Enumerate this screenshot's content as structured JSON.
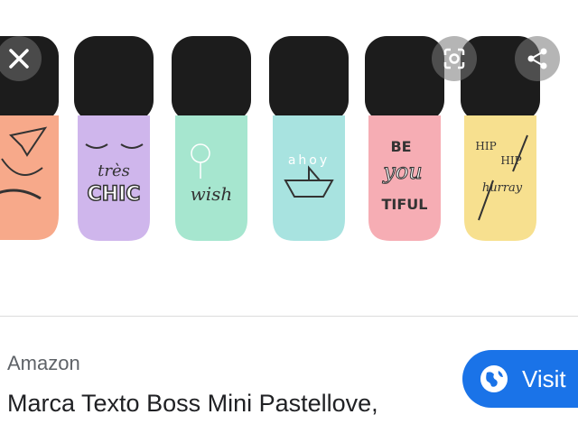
{
  "product_image": {
    "highlighters": [
      {
        "cap": "#1c1c1c",
        "body": "#f7a98a",
        "doodle": "paper-plane"
      },
      {
        "cap": "#1c1c1c",
        "body": "#cfb6ec",
        "doodle": "lashes",
        "text_lines": [
          "très",
          "CHIC"
        ]
      },
      {
        "cap": "#1c1c1c",
        "body": "#a6e6cf",
        "doodle": "dandelion",
        "text_lines": [
          "wish"
        ]
      },
      {
        "cap": "#1c1c1c",
        "body": "#a8e3e0",
        "doodle": "paper-boat",
        "text_lines": [
          "ahoy"
        ]
      },
      {
        "cap": "#1c1c1c",
        "body": "#f6adb4",
        "doodle": "lettering",
        "text_lines": [
          "BE",
          "you",
          "TIFUL"
        ]
      },
      {
        "cap": "#1c1c1c",
        "body": "#f7e08f",
        "doodle": "sticks",
        "text_lines": [
          "HIP",
          "HIP",
          "hurray"
        ]
      }
    ]
  },
  "controls": {
    "close_icon": "close-icon",
    "lens_icon": "lens-icon",
    "share_icon": "share-icon"
  },
  "result": {
    "source": "Amazon",
    "title": "Marca Texto Boss Mini Pastellove,",
    "visit_label": "Visit",
    "visit_icon": "globe-icon",
    "accent": "#1a73e8"
  }
}
